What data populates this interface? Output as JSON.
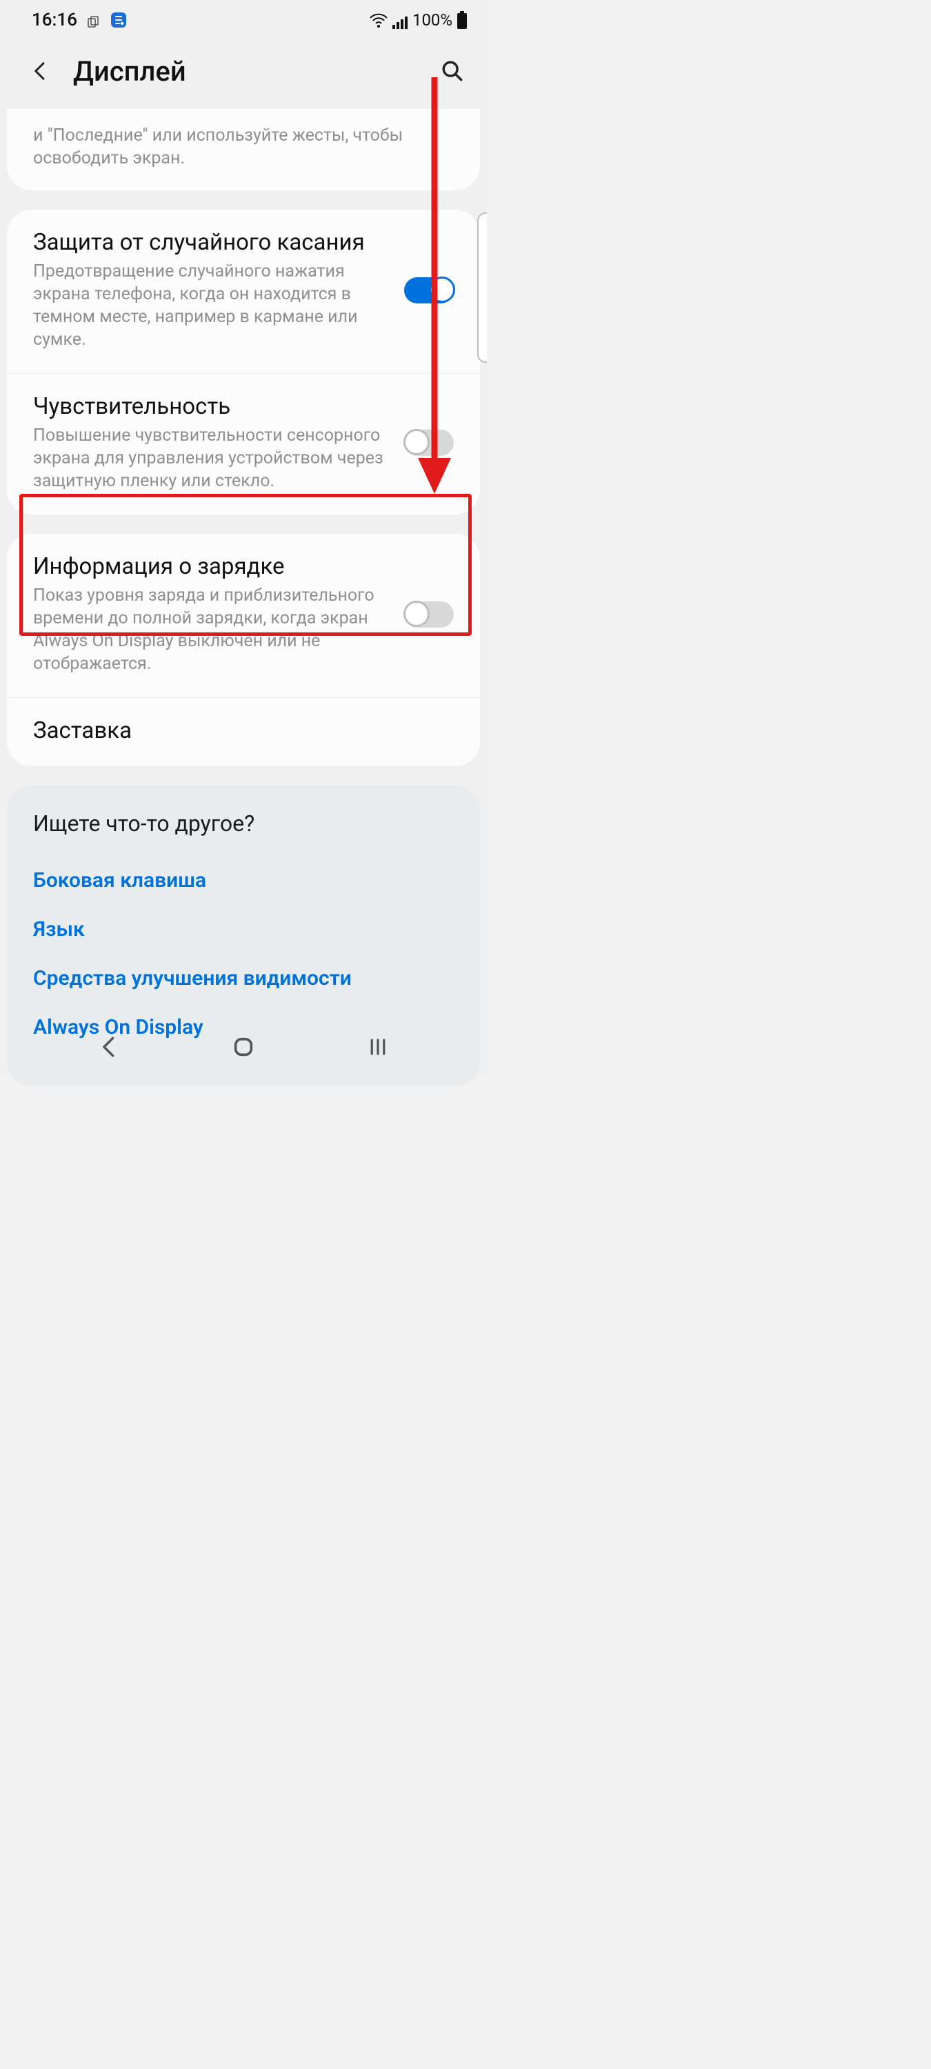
{
  "status": {
    "time": "16:16",
    "battery_text": "100%"
  },
  "appbar": {
    "title": "Дисплей"
  },
  "truncated": {
    "text": "и \"Последние\" или используйте жесты, чтобы освободить экран."
  },
  "settings": {
    "accidental_touch": {
      "title": "Защита от случайного касания",
      "desc": "Предотвращение случайного нажатия экрана телефона, когда он находится в темном месте, например в кармане или сумке.",
      "enabled": true
    },
    "sensitivity": {
      "title": "Чувствительность",
      "desc": "Повышение чувствительности сенсорного экрана для управления устройством через защитную пленку или стекло.",
      "enabled": false
    },
    "charging_info": {
      "title": "Информация о зарядке",
      "desc": "Показ уровня заряда и приблизительного времени до полной зарядки, когда экран Always On Display выключен или не отображается.",
      "enabled": false
    },
    "screensaver": {
      "title": "Заставка"
    }
  },
  "looking": {
    "heading": "Ищете что-то другое?",
    "links": {
      "side_key": "Боковая клавиша",
      "language": "Язык",
      "visibility": "Средства улучшения видимости",
      "aod": "Always On Display"
    }
  },
  "colors": {
    "accent": "#0072de",
    "annotation": "#e11b1b"
  }
}
